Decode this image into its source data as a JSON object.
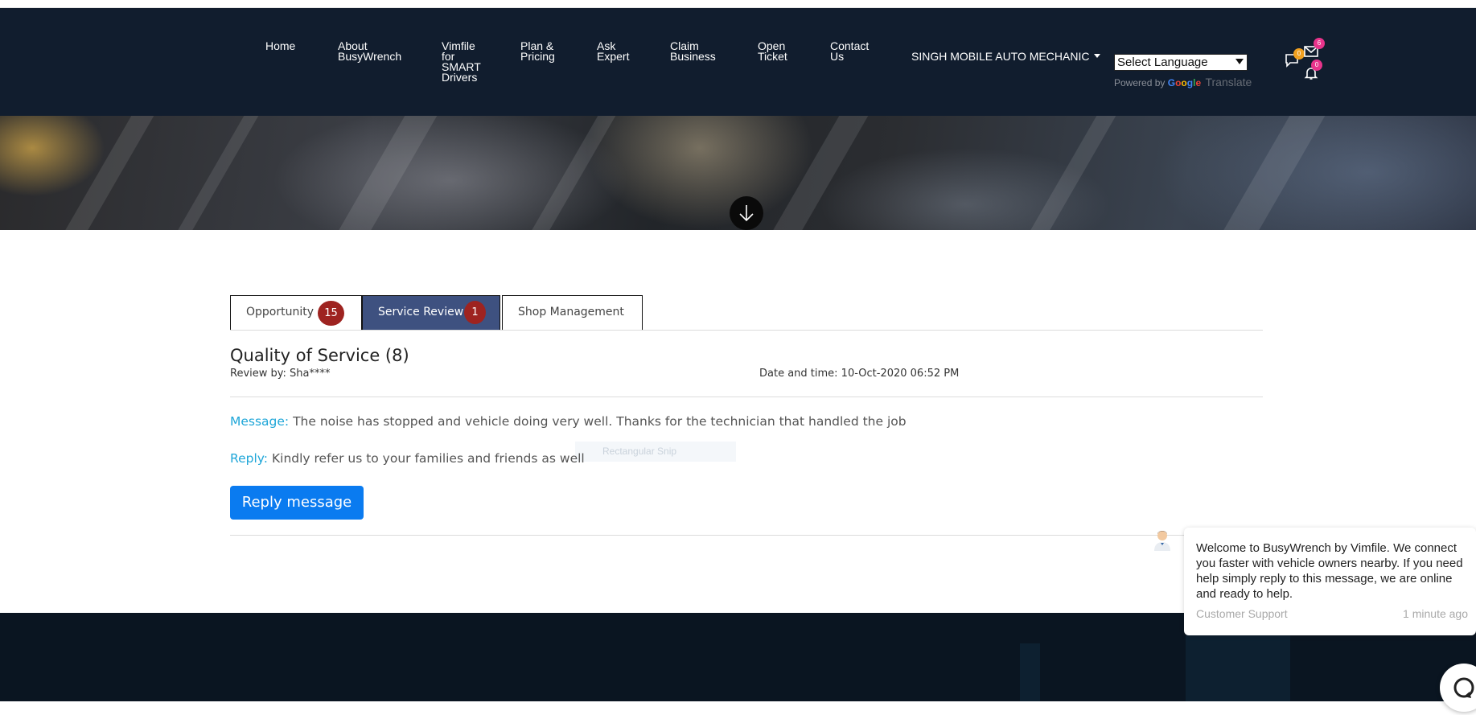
{
  "nav": {
    "items": [
      {
        "label": "Home"
      },
      {
        "label": "About\nBusyWrench"
      },
      {
        "label": "Vimfile\nfor\nSMART\nDrivers"
      },
      {
        "label": "Plan &\nPricing"
      },
      {
        "label": "Ask\nExpert"
      },
      {
        "label": "Claim\nBusiness"
      },
      {
        "label": "Open\nTicket"
      },
      {
        "label": "Contact\nUs"
      }
    ],
    "account_label": "SINGH MOBILE AUTO MECHANIC",
    "language_select": "Select Language",
    "powered_by": "Powered by",
    "google": "Google",
    "translate": "Translate",
    "messages_count": "6",
    "notifications_count": "0",
    "chat_count": "0"
  },
  "tabs": [
    {
      "label": "Opportunity",
      "count": "15"
    },
    {
      "label": "Service Review",
      "count": "1"
    },
    {
      "label": "Shop Management"
    }
  ],
  "review": {
    "title": "Quality of Service (8)",
    "review_by": "Review by: Sha****",
    "date_time": "Date and time: 10-Oct-2020 06:52 PM",
    "message_label": "Message:",
    "message_text": "The noise has stopped and vehicle doing very well. Thanks for the technician that handled the job",
    "reply_label": "Reply:",
    "reply_text": "Kindly refer us to your families and friends as well",
    "reply_button": "Reply message"
  },
  "ghost_overlay": "Rectangular Snip",
  "chat": {
    "message": "Welcome to BusyWrench by Vimfile. We connect you faster with vehicle owners nearby. If you need help simply reply to this message, we are online and ready to help.",
    "sender": "Customer Support",
    "time": "1 minute ago"
  },
  "colors": {
    "navbar": "#111d2e",
    "active_tab": "#3e5180",
    "badge": "#9e2320",
    "accent": "#1fa6d8",
    "primary_button": "#0a7bf0"
  }
}
